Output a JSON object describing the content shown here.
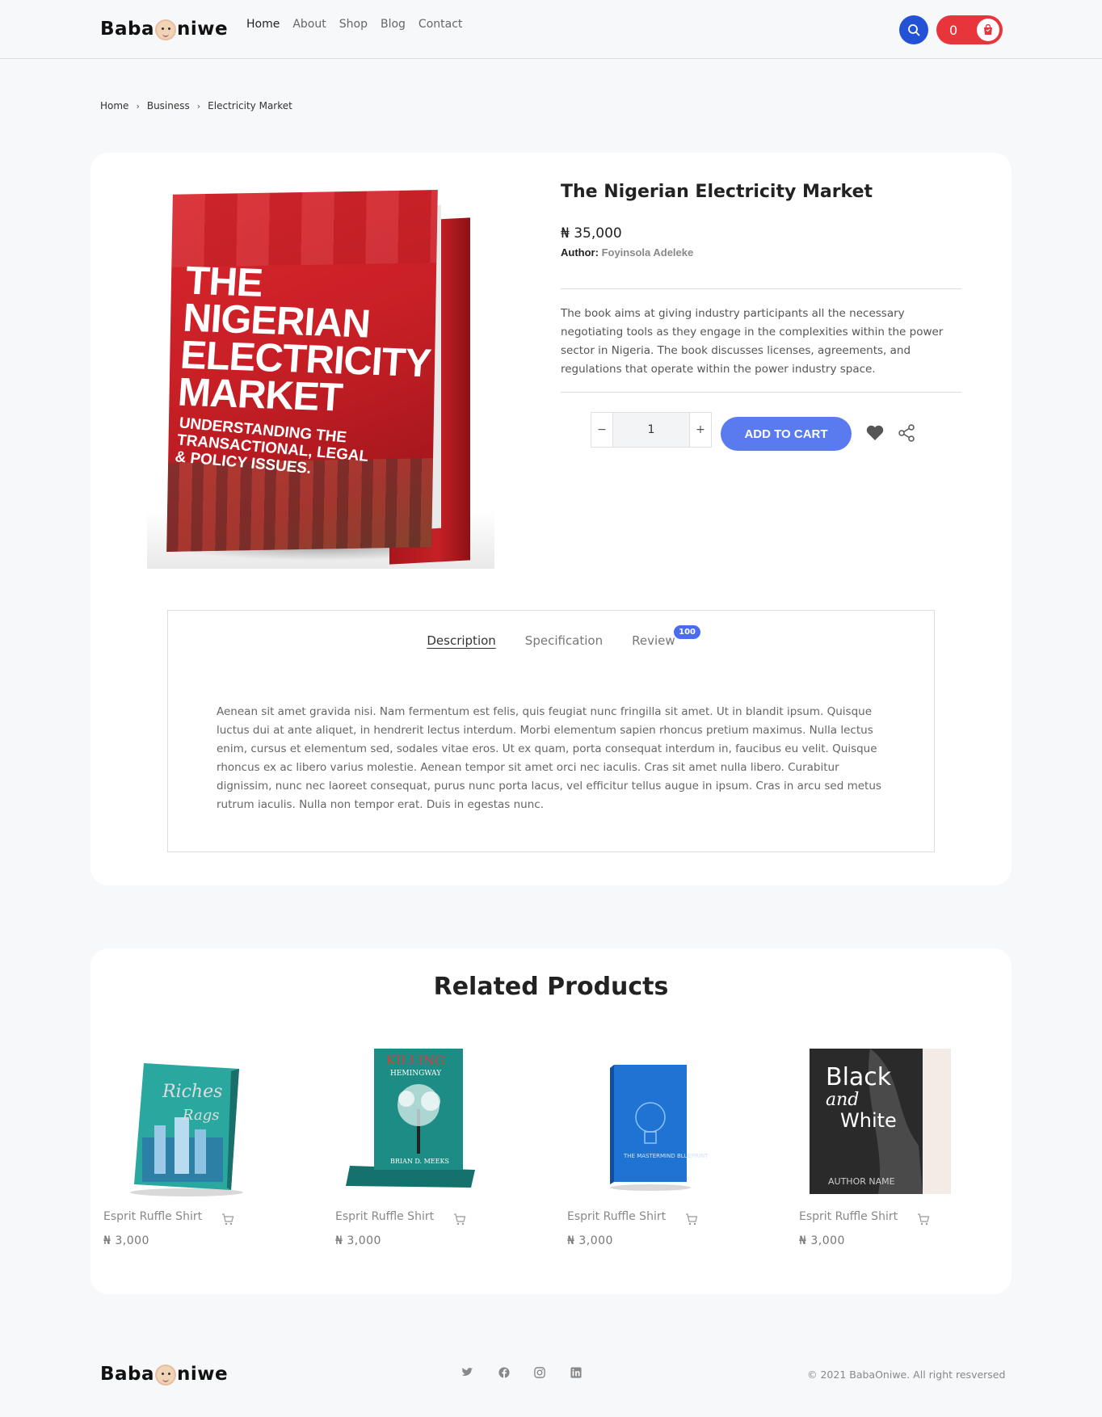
{
  "brand": {
    "logo_left": "Baba",
    "logo_right": "niwe"
  },
  "nav": {
    "items": [
      "Home",
      "About",
      "Shop",
      "Blog",
      "Contact"
    ],
    "active": "Home"
  },
  "cart": {
    "count": "0"
  },
  "breadcrumb": [
    "Home",
    "Business",
    "Electricity Market"
  ],
  "product": {
    "title": "The Nigerian Electricity Market",
    "price": "₦ 35,000",
    "author_label": "Author:",
    "author_name": "Foyinsola Adeleke",
    "description": "The book aims at giving industry participants all the necessary negotiating tools as they engage in the complexities within the power sector in Nigeria. The book discusses licenses, agreements, and regulations that operate within the power industry space.",
    "cover_title_lines": [
      "THE",
      "NIGERIAN",
      "ELECTRICITY",
      "MARKET"
    ],
    "cover_subtitle_lines": [
      "UNDERSTANDING THE",
      "TRANSACTIONAL, LEGAL",
      "& POLICY ISSUES."
    ],
    "quantity": "1",
    "minus_label": "−",
    "plus_label": "+",
    "add_to_cart": "ADD TO CART"
  },
  "tabs": {
    "items": [
      "Description",
      "Specification",
      "Review"
    ],
    "active": "Description",
    "review_count": "100",
    "body": "Aenean sit amet gravida nisi. Nam fermentum est felis, quis feugiat nunc fringilla sit amet. Ut in blandit ipsum. Quisque luctus dui at ante aliquet, in hendrerit lectus interdum. Morbi elementum sapien rhoncus pretium maximus. Nulla lectus enim, cursus et elementum sed, sodales vitae eros. Ut ex quam, porta consequat interdum in, faucibus eu velit. Quisque rhoncus ex ac libero varius molestie. Aenean tempor sit amet orci nec iaculis. Cras sit amet nulla libero. Curabitur dignissim, nunc nec laoreet consequat, purus nunc porta lacus, vel efficitur tellus augue in ipsum. Cras in arcu sed metus rutrum iaculis. Nulla non tempor erat. Duis in egestas nunc."
  },
  "related": {
    "title": "Related Products",
    "items": [
      {
        "name": "Esprit Ruffle Shirt",
        "price": "₦ 3,000",
        "cover": "Riches & Rags"
      },
      {
        "name": "Esprit Ruffle Shirt",
        "price": "₦ 3,000",
        "cover": "Killing Hemingway"
      },
      {
        "name": "Esprit Ruffle Shirt",
        "price": "₦ 3,000",
        "cover": "The Mastermind Blueprint"
      },
      {
        "name": "Esprit Ruffle Shirt",
        "price": "₦ 3,000",
        "cover": "Black and White"
      }
    ],
    "cover_texts": {
      "killing": "KILLING",
      "hemingway": "HEMINGWAY",
      "meeks": "BRIAN D. MEEKS",
      "mastermind": "THE MASTERMIND BLUEPRINT",
      "black": "Black",
      "and": "and",
      "white": "White",
      "author_name": "AUTHOR NAME"
    }
  },
  "footer": {
    "copyright": "© 2021 BabaOniwe. All right resversed",
    "social": [
      "twitter-icon",
      "facebook-icon",
      "instagram-icon",
      "linkedin-icon"
    ]
  },
  "colors": {
    "primary_blue": "#2352d6",
    "cart_red": "#e8353b",
    "button_blue": "#5a7bef",
    "book_red": "#c81f26"
  }
}
